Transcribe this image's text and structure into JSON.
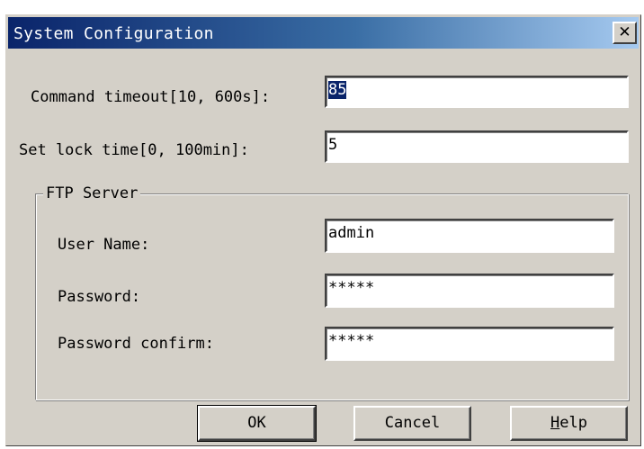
{
  "dialog": {
    "title": "System Configuration",
    "close_glyph": "✕"
  },
  "fields": {
    "command_timeout": {
      "label": "Command timeout[10, 600s]:",
      "value": "85"
    },
    "lock_time": {
      "label": "Set lock time[0, 100min]:",
      "value": "5"
    }
  },
  "ftp": {
    "group_label": "FTP Server",
    "user_name": {
      "label": "User Name:",
      "value": "admin"
    },
    "password": {
      "label": "Password:",
      "value": "*****"
    },
    "password_confirm": {
      "label": "Password confirm:",
      "value": "*****"
    }
  },
  "buttons": {
    "ok": "OK",
    "cancel": "Cancel",
    "help_first": "H",
    "help_rest": "elp"
  },
  "colors": {
    "dialog_bg": "#d4d0c8",
    "title_start": "#0a246a",
    "title_end": "#a6caf0",
    "selection": "#0a246a"
  },
  "icons": {
    "close": "close-icon"
  }
}
